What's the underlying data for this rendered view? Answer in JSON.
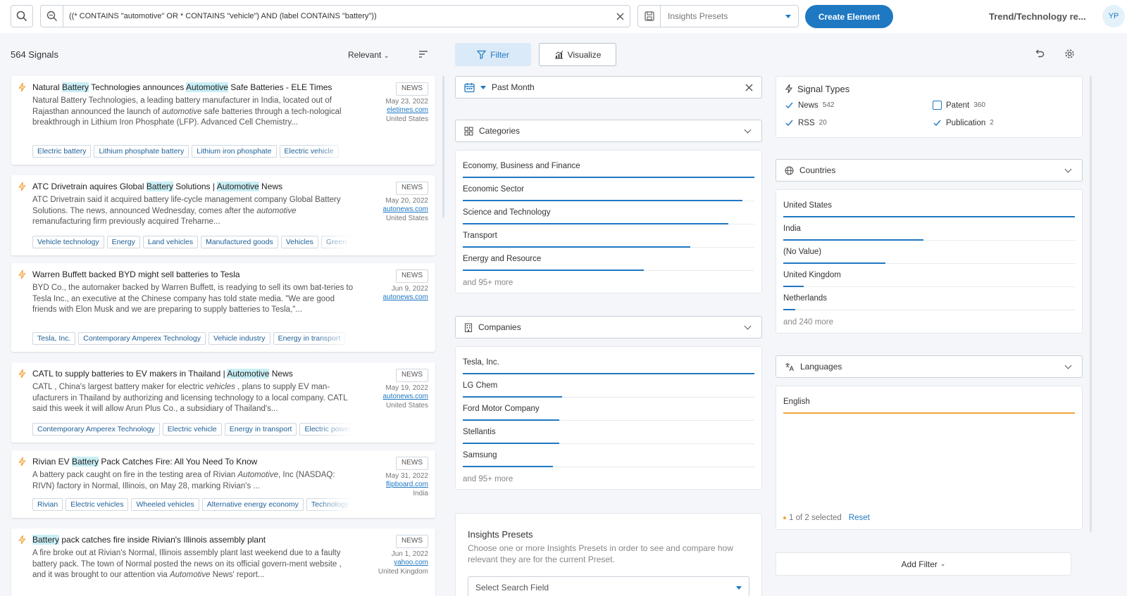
{
  "search": {
    "query": "((* CONTAINS \"automotive\" OR * CONTAINS \"vehicle\") AND (label CONTAINS \"battery\"))",
    "presets_placeholder": "Insights Presets",
    "create_label": "Create Element",
    "workspace_title": "Trend/Technology re...",
    "avatar": "YP"
  },
  "list": {
    "count_label": "564 Signals",
    "sort_label": "Relevant"
  },
  "cards": [
    {
      "title_parts": [
        {
          "t": "Natural "
        },
        {
          "t": "Battery",
          "hl": true
        },
        {
          "t": " Technologies announces "
        },
        {
          "t": "Automotive",
          "hl": true
        },
        {
          "t": " Safe Batteries - ELE Times"
        }
      ],
      "snippet_parts": [
        {
          "t": "Natural Battery Technologies, a leading battery manufacturer in India, located out of Rajasthan announced the launch of "
        },
        {
          "t": "automotive",
          "em": true
        },
        {
          "t": " safe batteries through a tech-nological breakthrough in Lithium Iron Phosphate (LFP). Advanced Cell Chemistry..."
        }
      ],
      "type": "NEWS",
      "date": "May 23, 2022",
      "source": "eletimes.com",
      "country": "United States",
      "tags": [
        "Electric battery",
        "Lithium phosphate battery",
        "Lithium iron phosphate",
        "Electric vehicle"
      ]
    },
    {
      "title_parts": [
        {
          "t": "ATC Drivetrain aquires Global "
        },
        {
          "t": "Battery",
          "hl": true
        },
        {
          "t": " Solutions | "
        },
        {
          "t": "Automotive",
          "hl": true
        },
        {
          "t": " News"
        }
      ],
      "snippet_parts": [
        {
          "t": "ATC Drivetrain said it acquired battery life-cycle management company Global Battery Solutions. The news, announced Wednesday, comes after the "
        },
        {
          "t": "automotive",
          "em": true
        },
        {
          "t": " remanufacturing firm previously acquired Treharne..."
        }
      ],
      "type": "NEWS",
      "date": "May 20, 2022",
      "source": "autonews.com",
      "country": "United States",
      "tags": [
        "Vehicle technology",
        "Energy",
        "Land vehicles",
        "Manufactured goods",
        "Vehicles",
        "Green"
      ]
    },
    {
      "title_parts": [
        {
          "t": "Warren Buffett backed BYD might sell batteries to Tesla"
        }
      ],
      "snippet_parts": [
        {
          "t": "BYD Co., the automaker backed by Warren Buffett, is readying to sell its own bat-teries to Tesla Inc., an executive at the Chinese company has told state media. \"We are good friends with Elon Musk and we are preparing to supply batteries to Tesla,\"..."
        }
      ],
      "type": "NEWS",
      "date": "Jun 9, 2022",
      "source": "autonews.com",
      "country": "",
      "tags": [
        "Tesla, Inc.",
        "Contemporary Amperex Technology",
        "Vehicle industry",
        "Energy in transport"
      ]
    },
    {
      "title_parts": [
        {
          "t": "CATL to supply batteries to EV makers in Thailand | "
        },
        {
          "t": "Automotive",
          "hl": true
        },
        {
          "t": " News"
        }
      ],
      "snippet_parts": [
        {
          "t": "CATL , China's largest battery maker for electric "
        },
        {
          "t": "vehicles",
          "em": true
        },
        {
          "t": " , plans to supply EV man-ufacturers in Thailand by authorizing and licensing technology to a local company. CATL said this week it will allow Arun Plus Co., a subsidiary of Thailand's..."
        }
      ],
      "type": "NEWS",
      "date": "May 19, 2022",
      "source": "autonews.com",
      "country": "United States",
      "tags": [
        "Contemporary Amperex Technology",
        "Electric vehicle",
        "Energy in transport",
        "Electric power"
      ]
    },
    {
      "title_parts": [
        {
          "t": "Rivian EV "
        },
        {
          "t": "Battery",
          "hl": true
        },
        {
          "t": " Pack Catches Fire: All You Need To Know"
        }
      ],
      "snippet_parts": [
        {
          "t": "A battery pack caught on fire in the testing area of Rivian "
        },
        {
          "t": "Automotive",
          "em": true
        },
        {
          "t": ", Inc (NASDAQ: RIVN) factory in Normal, Illinois, on May 28, marking Rivian's ..."
        }
      ],
      "type": "NEWS",
      "date": "May 31, 2022",
      "source": "flipboard.com",
      "country": "India",
      "tags": [
        "Rivian",
        "Electric vehicles",
        "Wheeled vehicles",
        "Alternative energy economy",
        "Technology"
      ]
    },
    {
      "title_parts": [
        {
          "t": "Battery",
          "hl": true
        },
        {
          "t": " pack catches fire inside Rivian's Illinois assembly plant"
        }
      ],
      "snippet_parts": [
        {
          "t": "A fire broke out at Rivian's Normal, Illinois assembly plant last weekend due to a faulty battery pack. The town of Normal posted the news on its official govern-ment website , and it was brought to our attention via "
        },
        {
          "t": "Automotive",
          "em": true
        },
        {
          "t": " News' report..."
        }
      ],
      "type": "NEWS",
      "date": "Jun 1, 2022",
      "source": "yahoo.com",
      "country": "United Kingdom",
      "tags": []
    }
  ],
  "filter": {
    "filter_label": "Filter",
    "visualize_label": "Visualize",
    "date_label": "Past Month",
    "categories": {
      "label": "Categories",
      "items": [
        {
          "name": "Economy, Business and Finance",
          "share": 1.0
        },
        {
          "name": "Economic Sector",
          "share": 0.96
        },
        {
          "name": "Science and Technology",
          "share": 0.91
        },
        {
          "name": "Transport",
          "share": 0.78
        },
        {
          "name": "Energy and Resource",
          "share": 0.62
        }
      ],
      "more": "and 95+ more"
    },
    "companies": {
      "label": "Companies",
      "items": [
        {
          "name": "Tesla, Inc.",
          "share": 1.0
        },
        {
          "name": "LG Chem",
          "share": 0.34
        },
        {
          "name": "Ford Motor Company",
          "share": 0.33
        },
        {
          "name": "Stellantis",
          "share": 0.33
        },
        {
          "name": "Samsung",
          "share": 0.31
        }
      ],
      "more": "and 95+ more"
    },
    "signal_types": {
      "label": "Signal Types",
      "items": [
        {
          "name": "News",
          "count": "542",
          "checked": true
        },
        {
          "name": "Patent",
          "count": "360",
          "checked": false
        },
        {
          "name": "RSS",
          "count": "20",
          "checked": true
        },
        {
          "name": "Publication",
          "count": "2",
          "checked": true
        }
      ]
    },
    "countries": {
      "label": "Countries",
      "items": [
        {
          "name": "United States",
          "share": 1.0
        },
        {
          "name": "India",
          "share": 0.48
        },
        {
          "name": "(No Value)",
          "share": 0.35
        },
        {
          "name": "United Kingdom",
          "share": 0.07
        },
        {
          "name": "Netherlands",
          "share": 0.04
        }
      ],
      "more": "and 240 more"
    },
    "languages": {
      "label": "Languages",
      "items": [
        {
          "name": "English",
          "share": 1.0
        }
      ],
      "selected_text": "1 of 2 selected",
      "reset_label": "Reset"
    },
    "presets": {
      "title": "Insights Presets",
      "description": "Choose one or more Insights Presets in order to see and compare how relevant they are for the current Preset.",
      "select_placeholder": "Select Search Field"
    },
    "add_filter_label": "Add Filter"
  },
  "colors": {
    "accent": "#1e78c2",
    "highlight": "#c9eff5",
    "bolt": "#f2a33a",
    "language_bar": "#f2a33a"
  }
}
